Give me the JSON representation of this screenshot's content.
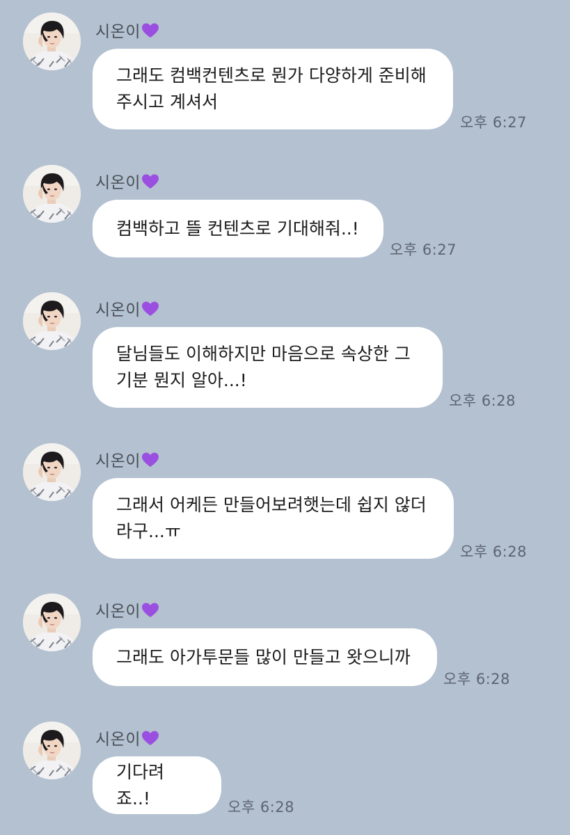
{
  "accent_colors": {
    "background": "#b3c1d1",
    "bubble": "#ffffff",
    "heart": "#9b4fe0"
  },
  "messages": [
    {
      "sender": "시온이",
      "text": "그래도 컴백컨텐츠로 뭔가 다양하게 준비해\n주시고 계셔서",
      "time": "오후 6:27"
    },
    {
      "sender": "시온이",
      "text": "컴백하고 뜰 컨텐츠로 기대해줘..!",
      "time": "오후 6:27"
    },
    {
      "sender": "시온이",
      "text": "달님들도 이해하지만 마음으로 속상한 그\n기분 뭔지 알아...!",
      "time": "오후 6:28"
    },
    {
      "sender": "시온이",
      "text": "그래서 어케든 만들어보려햇는데 쉽지 않더\n라구...ㅠ",
      "time": "오후 6:28"
    },
    {
      "sender": "시온이",
      "text": "그래도 아가투문들 많이 만들고 왓으니까",
      "time": "오후 6:28"
    },
    {
      "sender": "시온이",
      "text": "기다려죠..!",
      "time": "오후 6:28"
    }
  ],
  "icons": {
    "sender_badge": "purple-heart-icon",
    "avatar": "profile-photo"
  }
}
